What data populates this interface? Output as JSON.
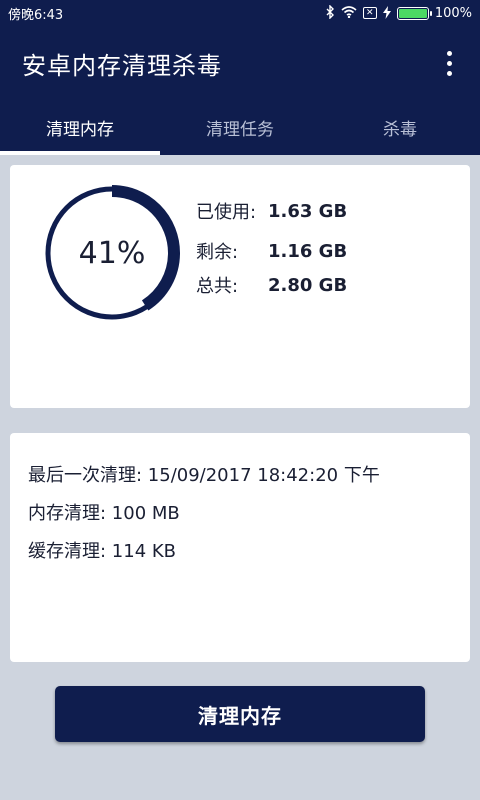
{
  "status_bar": {
    "time": "傍晚6:43",
    "battery_percent": "100%",
    "battery_level": 1.0,
    "icons": [
      "bluetooth-icon",
      "wifi-icon",
      "sim-icon",
      "charging-icon",
      "battery-icon"
    ],
    "battery_color": "#4cd964"
  },
  "app_bar": {
    "title": "安卓内存清理杀毒",
    "menu_icon": "more-vert-icon"
  },
  "tabs": [
    {
      "label": "清理内存",
      "active": true
    },
    {
      "label": "清理任务",
      "active": false
    },
    {
      "label": "杀毒",
      "active": false
    }
  ],
  "memory": {
    "percent_label": "41%",
    "percent_value": 41,
    "used_label": "已使用:",
    "used_value": "1.63 GB",
    "free_label": "剩余:",
    "free_value": "1.16 GB",
    "total_label": "总共:",
    "total_value": "2.80 GB"
  },
  "clean_info": {
    "last_clean": "最后一次清理: 15/09/2017 18:42:20 下午",
    "memory_cleaned": "内存清理: 100 MB",
    "cache_cleaned": "缓存清理: 114 KB"
  },
  "actions": {
    "clean_button_label": "清理内存"
  },
  "colors": {
    "primary": "#0f1d4e",
    "background": "#ced4de",
    "card": "#ffffff",
    "ring_track": "#0f1d4e"
  }
}
